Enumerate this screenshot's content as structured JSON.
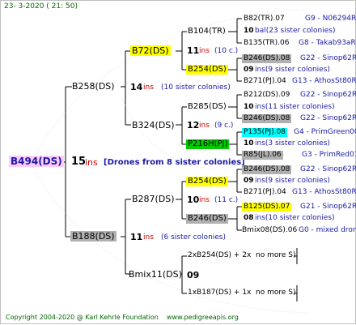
{
  "header": {
    "date": "23-  3-2020 ( 21: 50)"
  },
  "footer": {
    "copyright": "Copyright 2004-2020 @ Karl Kehrle Foundation",
    "site": "www.pedigreeapis.org"
  },
  "colors": {
    "yellow": "#ffff00",
    "green": "#00cc00",
    "cyan": "#00ffff",
    "gray": "#b0b0b0",
    "pink": "#ffccff",
    "blue_text": "#1a1aa6",
    "red_text": "#cc0000"
  },
  "root": {
    "id": "B494(DS)",
    "num": "15",
    "unit": "ins",
    "note": "[Drones from 8 sister colonies]"
  },
  "gen1": [
    {
      "id": "B258(DS)",
      "num": "14",
      "unit": "ins",
      "note": "(10 sister colonies)"
    },
    {
      "id": "B188(DS)",
      "num": "11",
      "unit": "ins",
      "note": "(6 sister colonies)"
    }
  ],
  "gen2": [
    {
      "id": "B72(DS)",
      "num": "11",
      "unit": "ins",
      "note": "(10 c.)"
    },
    {
      "id": "B324(DS)",
      "num": "12",
      "unit": "ins",
      "note": "(9 c.)"
    },
    {
      "id": "B287(DS)",
      "num": "10",
      "unit": "ins",
      "note": "(11 c.)"
    },
    {
      "id": "Bmix11(DS)",
      "num": "09",
      "unit": "",
      "note": ""
    }
  ],
  "gen3": [
    {
      "id": "B104(TR)"
    },
    {
      "id": "B254(DS)"
    },
    {
      "id": "B285(DS)"
    },
    {
      "id": "P216H(PJ)"
    },
    {
      "id": "B254(DS)"
    },
    {
      "id": "B246(DS)"
    },
    {
      "id": "2xB254(DS) + 2x",
      "tail": "no more S)"
    },
    {
      "id": "1xB187(DS) + 1x",
      "tail": "no more S)"
    }
  ],
  "gen4": [
    {
      "id": "B82(TR).07",
      "info": "G9 - N06294R"
    },
    {
      "id": "10",
      "sub": "bal(23 sister colonies)"
    },
    {
      "id": "B135(TR).06",
      "info": "G8 - Takab93aR"
    },
    {
      "id": "B246(DS).08",
      "info": "G22 - Sinop62R"
    },
    {
      "id": "09",
      "sub": "ins(9 sister colonies)"
    },
    {
      "id": "B271(PJ).04",
      "info": "G13 - AthosSt80R"
    },
    {
      "id": "B212(DS).09",
      "info": "G22 - Sinop62R"
    },
    {
      "id": "10",
      "sub": "ins(11 sister colonies)"
    },
    {
      "id": "B246(DS).08",
      "info": "G22 - Sinop62R"
    },
    {
      "id": "P135(PJ).08",
      "info": "G4 - PrimGreen00"
    },
    {
      "id": "10",
      "sub": "ins(3 sister colonies)"
    },
    {
      "id": "R85(JL).06",
      "info": "G3 - PrimRed01"
    },
    {
      "id": "B246(DS).08",
      "info": "G22 - Sinop62R"
    },
    {
      "id": "09",
      "sub": "ins(9 sister colonies)"
    },
    {
      "id": "B271(PJ).04",
      "info": "G13 - AthosSt80R"
    },
    {
      "id": "B125(DS).07",
      "info": "G21 - Sinop62R"
    },
    {
      "id": "08",
      "sub": "ins(10 sister colonies)"
    },
    {
      "id": "Bmix08(DS).06",
      "info": "G0 - mixed drone"
    }
  ]
}
